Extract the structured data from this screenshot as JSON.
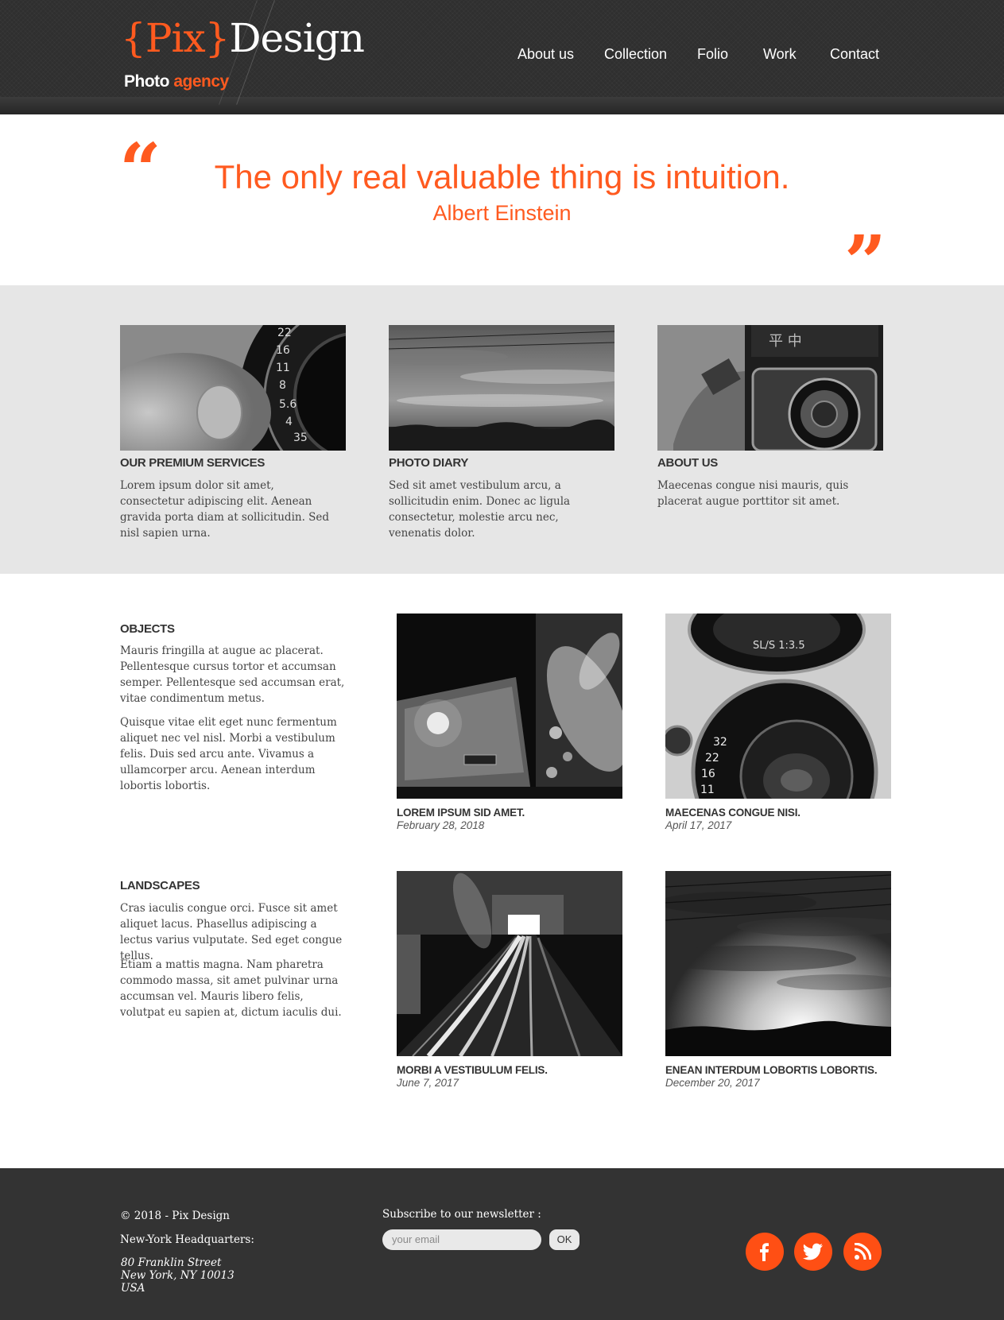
{
  "header": {
    "logo": {
      "open_brace": "{",
      "pix": "Pix",
      "close_brace": "}",
      "design": "Design"
    },
    "tagline": {
      "photo": "Photo",
      "agency": "agency"
    },
    "nav": [
      "About us",
      "Collection",
      "Folio",
      "Work",
      "Contact"
    ]
  },
  "quote": {
    "open_mark": "“",
    "close_mark": "”",
    "text": "The only real valuable thing is intuition.",
    "author": "Albert Einstein"
  },
  "features": [
    {
      "title": "OUR PREMIUM SERVICES",
      "text": "Lorem ipsum dolor sit amet, consectetur adipiscing elit. Aenean gravida porta diam at sollicitudin. Sed nisl sapien urna.",
      "image": "camera-lens-dial"
    },
    {
      "title": "PHOTO DIARY",
      "text": "Sed sit amet vestibulum arcu, a sollicitudin enim. Donec ac ligula consectetur, molestie arcu nec, venenatis dolor.",
      "image": "cloudy-sky"
    },
    {
      "title": "ABOUT US",
      "text": "Maecenas congue nisi mauris, quis placerat augue porttitor sit amet.",
      "image": "vintage-camera"
    }
  ],
  "gallery": [
    {
      "title": "OBJECTS",
      "paragraphs": [
        "Mauris fringilla at augue ac placerat. Pellentesque cursus tortor et accumsan semper. Pellentesque sed accumsan erat, vitae condimentum metus.",
        "Quisque vitae elit eget nunc fermentum aliquet nec vel nisl. Morbi a vestibulum felis. Duis sed arcu ante. Vivamus a ullamcorper arcu. Aenean interdum lobortis lobortis."
      ],
      "photos": [
        {
          "caption": "LOREM IPSUM SID AMET.",
          "date": "February 28, 2018",
          "image": "night-building"
        },
        {
          "caption": "MAECENAS CONGUE NISI.",
          "date": "April 17, 2017",
          "image": "camera-lenses"
        }
      ]
    },
    {
      "title": "LANDSCAPES",
      "paragraphs": [
        "Cras iaculis congue orci. Fusce sit amet aliquet lacus. Phasellus adipiscing a lectus varius vulputate. Sed eget congue tellus.",
        "Etiam a mattis magna. Nam pharetra commodo massa, sit amet pulvinar urna accumsan vel. Mauris libero felis, volutpat eu sapien at, dictum iaculis dui."
      ],
      "photos": [
        {
          "caption": "MORBI A VESTIBULUM FELIS.",
          "date": "June 7, 2017",
          "image": "light-trails"
        },
        {
          "caption": "ENEAN INTERDUM LOBORTIS LOBORTIS.",
          "date": "December 20, 2017",
          "image": "sunset-clouds"
        }
      ]
    }
  ],
  "footer": {
    "copyright": "© 2018 - Pix Design",
    "hq_label": "New-York Headquarters:",
    "address": [
      "80 Franklin Street",
      "New York, NY 10013",
      "USA"
    ],
    "newsletter_label": "Subscribe to our newsletter :",
    "email_placeholder": "your email",
    "ok_label": "OK",
    "social": [
      "facebook-icon",
      "twitter-icon",
      "rss-icon"
    ]
  },
  "colors": {
    "accent": "#ff5a1f",
    "header_bg": "#2f2f2f",
    "band_bg": "#e6e6e6",
    "footer_bg": "#333333"
  }
}
